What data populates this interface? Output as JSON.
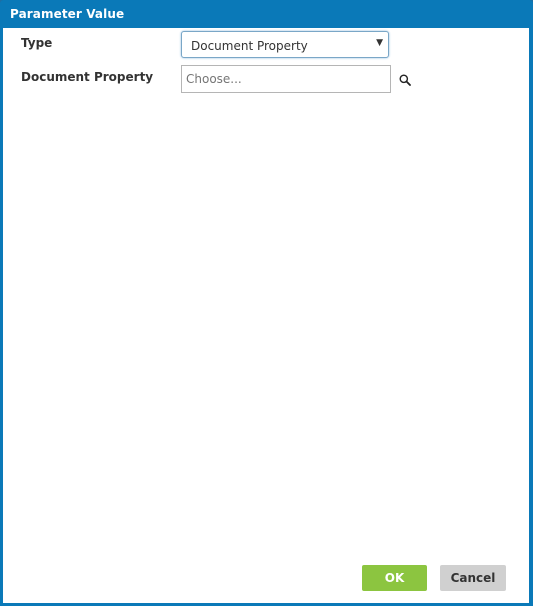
{
  "dialog": {
    "title": "Parameter Value"
  },
  "form": {
    "type_label": "Type",
    "type_value": "Document Property",
    "document_property_label": "Document Property",
    "document_property_placeholder": "Choose..."
  },
  "buttons": {
    "ok_label": "OK",
    "cancel_label": "Cancel"
  },
  "icons": {
    "dropdown": "caret-down-icon",
    "search": "search-icon"
  },
  "colors": {
    "titlebar": "#0a79b8",
    "ok_button": "#8cc540",
    "cancel_button": "#d0d0d0"
  }
}
